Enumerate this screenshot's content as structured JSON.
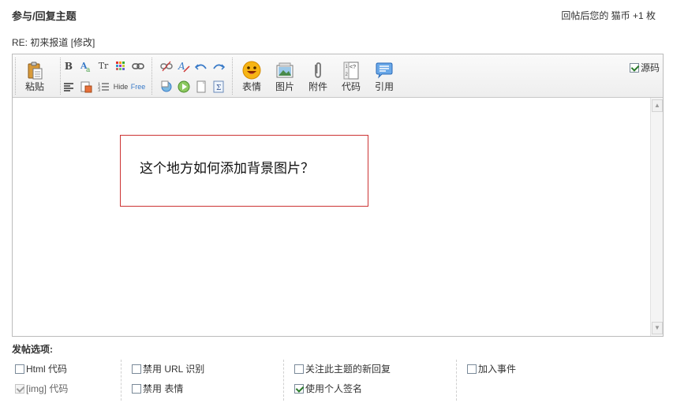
{
  "header": {
    "title": "参与/回复主题",
    "reward": "回帖后您的 猫币 +1 枚"
  },
  "subject": {
    "prefix": "RE: 初来报道",
    "edit_label": "[修改]"
  },
  "toolbar": {
    "paste_label": "粘贴",
    "emoticon_label": "表情",
    "image_label": "图片",
    "attachment_label": "附件",
    "code_label": "代码",
    "quote_label": "引用",
    "source_label": "源码",
    "source_checked": true,
    "bold_glyph": "B",
    "font_size_glyph": "Tr",
    "hide_glyph": "Hide",
    "free_glyph": "Free"
  },
  "editor": {
    "content": "这个地方如何添加背景图片？",
    "box_border_color": "#cc3333"
  },
  "options": {
    "title": "发帖选项:",
    "items": [
      {
        "label": "Html 代码",
        "checked": false,
        "disabled": false
      },
      {
        "label": "[img] 代码",
        "checked": true,
        "disabled": true
      },
      {
        "label": "禁用  URL 识别",
        "checked": false,
        "disabled": false
      },
      {
        "label": "禁用  表情",
        "checked": false,
        "disabled": false
      },
      {
        "label": "关注此主题的新回复",
        "checked": false,
        "disabled": false
      },
      {
        "label": "使用个人签名",
        "checked": true,
        "disabled": false
      },
      {
        "label": "加入事件",
        "checked": false,
        "disabled": false
      }
    ]
  }
}
